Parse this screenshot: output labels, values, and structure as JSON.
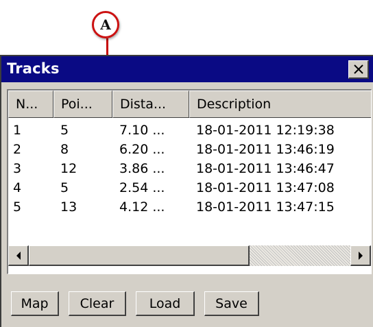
{
  "callout": {
    "letter": "A"
  },
  "window": {
    "title": "Tracks",
    "close_icon": "close-icon"
  },
  "table": {
    "columns": [
      "N...",
      "Poi...",
      "Dista...",
      "Description"
    ],
    "rows": [
      [
        "1",
        "5",
        "7.10 ...",
        "18-01-2011 12:19:38"
      ],
      [
        "2",
        "8",
        "6.20 ...",
        "18-01-2011 13:46:19"
      ],
      [
        "3",
        "12",
        "3.86 ...",
        "18-01-2011 13:46:47"
      ],
      [
        "4",
        "5",
        "2.54 ...",
        "18-01-2011 13:47:08"
      ],
      [
        "5",
        "13",
        "4.12 ...",
        "18-01-2011 13:47:15"
      ]
    ]
  },
  "scrollbar": {
    "left_icon": "arrow-left-icon",
    "right_icon": "arrow-right-icon"
  },
  "buttons": {
    "map": "Map",
    "clear": "Clear",
    "load": "Load",
    "save": "Save"
  },
  "colors": {
    "titlebar": "#0a0a84",
    "window_face": "#d4d0c8",
    "callout_red": "#cc1111"
  }
}
